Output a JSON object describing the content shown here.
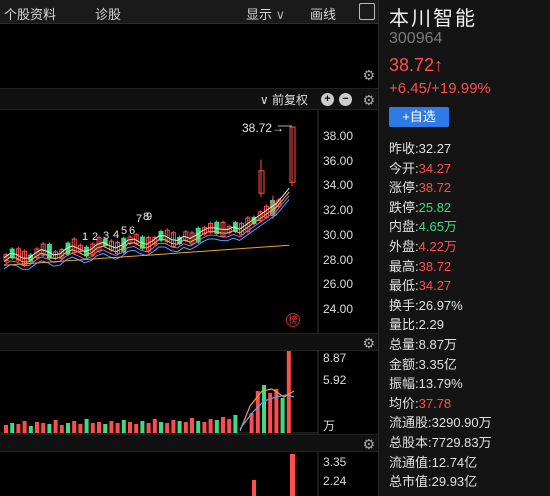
{
  "toolbar": {
    "tab1": "个股资料",
    "tab2": "诊股",
    "display": "显示",
    "draw": "画线"
  },
  "chart_header": {
    "adjust": "前复权"
  },
  "kline": {
    "price_axis": [
      "38.00",
      "36.00",
      "34.00",
      "32.00",
      "30.00",
      "28.00",
      "26.00",
      "24.00"
    ],
    "last_price_tag": "38.72→",
    "marker_digits": [
      "1",
      "2",
      "3",
      "4",
      "5",
      "6",
      "7",
      "8",
      "9"
    ],
    "badge": "榜"
  },
  "volume": {
    "axis": [
      "8.87",
      "5.92"
    ],
    "unit": "万"
  },
  "indicator": {
    "axis": [
      "3.35",
      "2.24"
    ]
  },
  "colors": {
    "up": "#ff4d4d",
    "down": "#3ddc84",
    "accent": "#2f7ae5"
  },
  "stock": {
    "name": "本川智能",
    "code": "300964",
    "price": "38.72↑",
    "change": "+6.45/+19.99%",
    "add_label": "+自选"
  },
  "quotes": [
    {
      "label": "昨收:",
      "value": "32.27",
      "color": "white"
    },
    {
      "label": "今开:",
      "value": "34.27",
      "color": "red"
    },
    {
      "label": "涨停:",
      "value": "38.72",
      "color": "red"
    },
    {
      "label": "跌停:",
      "value": "25.82",
      "color": "green"
    },
    {
      "label": "内盘:",
      "value": "4.65万",
      "color": "green"
    },
    {
      "label": "外盘:",
      "value": "4.22万",
      "color": "red"
    },
    {
      "label": "最高:",
      "value": "38.72",
      "color": "red"
    },
    {
      "label": "最低:",
      "value": "34.27",
      "color": "red"
    },
    {
      "label": "换手:",
      "value": "26.97%",
      "color": "white"
    },
    {
      "label": "量比:",
      "value": "2.29",
      "color": "white"
    },
    {
      "label": "总量:",
      "value": "8.87万",
      "color": "white"
    },
    {
      "label": "金额:",
      "value": "3.35亿",
      "color": "white"
    },
    {
      "label": "振幅:",
      "value": "13.79%",
      "color": "white"
    },
    {
      "label": "均价:",
      "value": "37.78",
      "color": "red"
    },
    {
      "label": "流通股:",
      "value": "3290.90万",
      "color": "white"
    },
    {
      "label": "总股本:",
      "value": "7729.83万",
      "color": "white"
    },
    {
      "label": "流通值:",
      "value": "12.74亿",
      "color": "white"
    },
    {
      "label": "总市值:",
      "value": "29.93亿",
      "color": "white"
    }
  ]
}
